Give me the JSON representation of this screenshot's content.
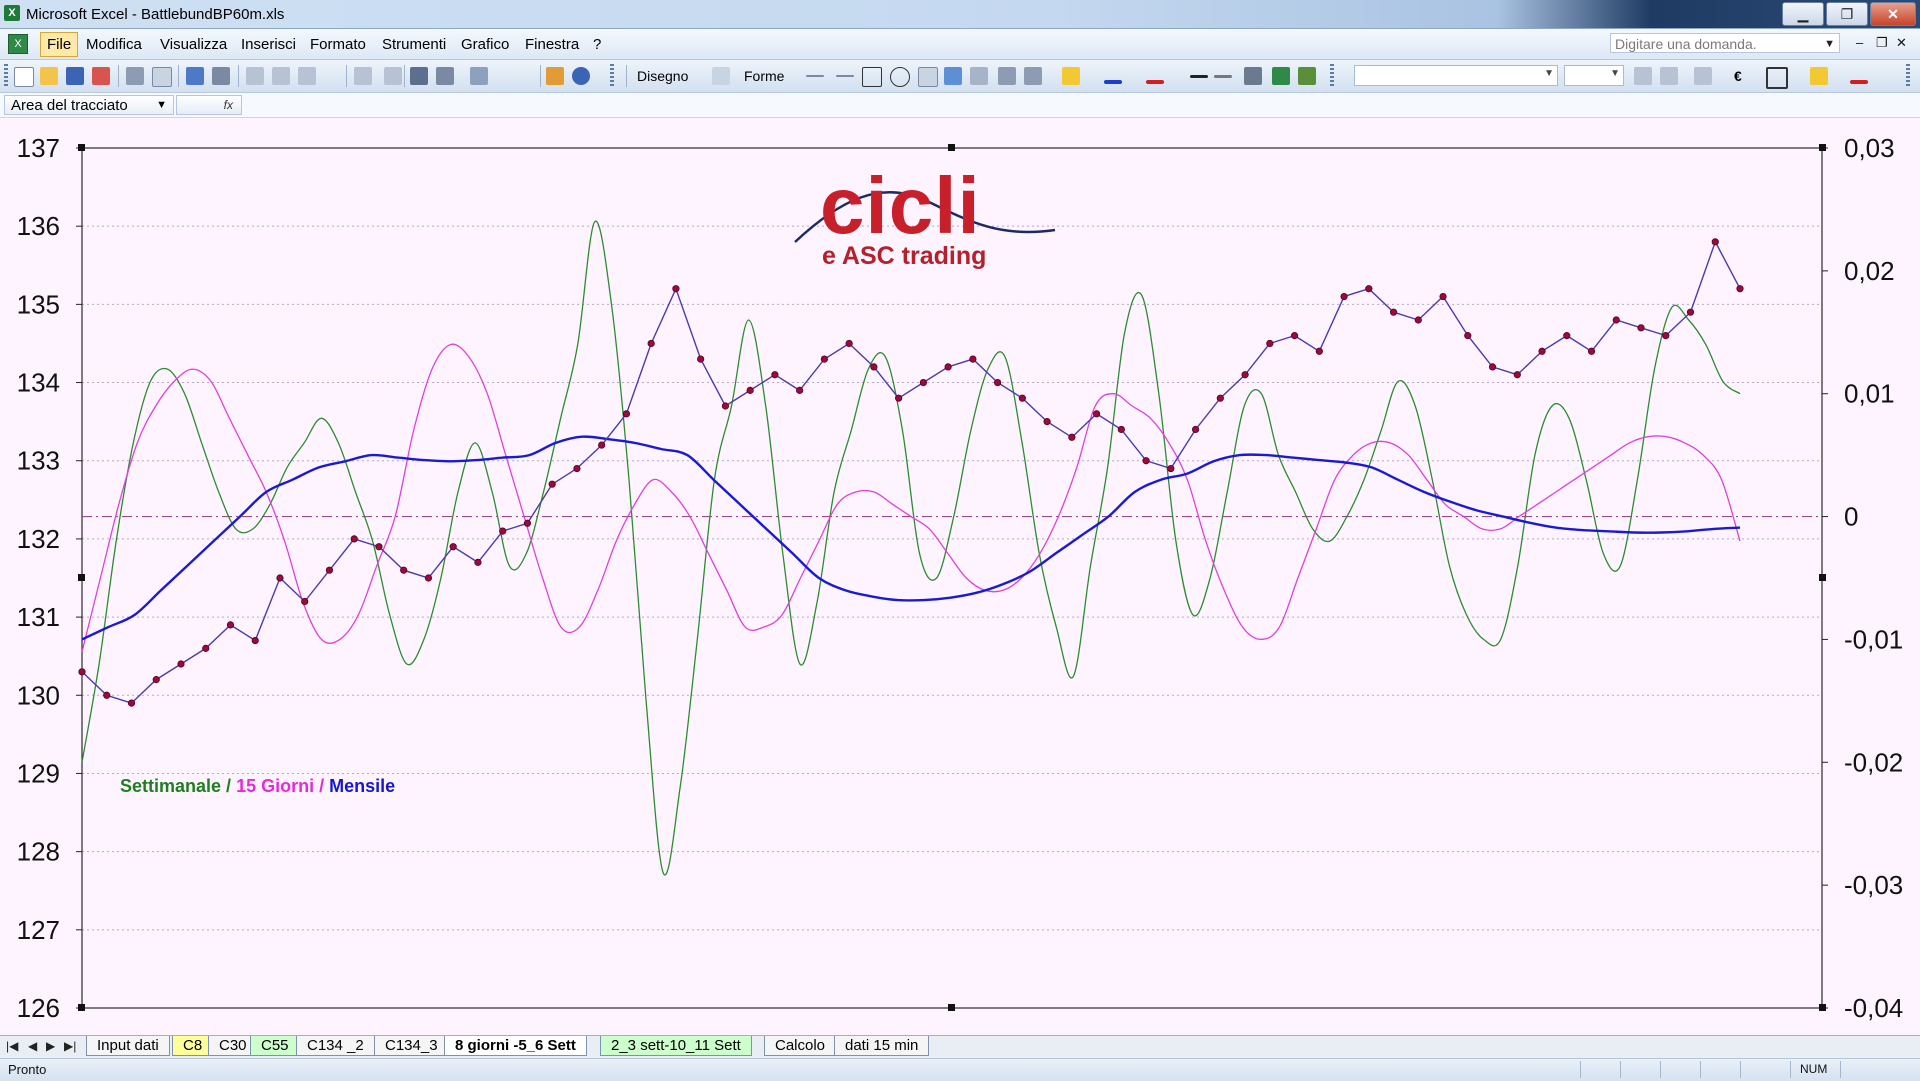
{
  "window": {
    "title": "Microsoft Excel - BattlebundBP60m.xls",
    "minimize": "▁",
    "restore": "❐",
    "close": "✕"
  },
  "menu": {
    "items": [
      "File",
      "Modifica",
      "Visualizza",
      "Inserisci",
      "Formato",
      "Strumenti",
      "Grafico",
      "Finestra",
      "?"
    ],
    "ask_placeholder": "Digitare una domanda.",
    "ask_dropdown": "▼",
    "doc_minimize": "–",
    "doc_restore": "❐",
    "doc_close": "✕"
  },
  "toolbar": {
    "drawing_label": "Disegno",
    "shapes_label": "Forme",
    "euro": "€"
  },
  "namebox": {
    "value": "Area del tracciato",
    "dropdown": "▼",
    "fx": "fx"
  },
  "chart": {
    "logo_main": "cicli",
    "logo_sub": "e ASC trading",
    "legend": {
      "weekly": "Settimanale",
      "sep1": " / ",
      "biweekly": "15 Giorni",
      "sep2": " / ",
      "monthly": "Mensile"
    },
    "colors": {
      "weekly": "#2e8b2e",
      "biweekly": "#e040d8",
      "monthly": "#1a1ad6",
      "price": "#9a0a3a",
      "price_line": "#4a3ab0",
      "zero_line": "#9b4a8a"
    }
  },
  "chart_data": {
    "type": "line",
    "title": "",
    "y_left": {
      "range": [
        126,
        137
      ],
      "ticks": [
        "137",
        "136",
        "135",
        "134",
        "133",
        "132",
        "131",
        "130",
        "129",
        "128",
        "127",
        "126"
      ]
    },
    "y_right": {
      "range": [
        -0.04,
        0.03
      ],
      "ticks": [
        "0,03",
        "0,02",
        "0,01",
        "0",
        "-0,01",
        "-0,02",
        "-0,03",
        "-0,04"
      ]
    },
    "x_count": 100,
    "grid": "horizontal dotted",
    "series": [
      {
        "name": "Settimanale",
        "axis": "right",
        "values": [
          -0.02,
          -0.012,
          -0.002,
          0.006,
          0.011,
          0.012,
          0.01,
          0.006,
          0.002,
          -0.001,
          -0.001,
          0.001,
          0.004,
          0.006,
          0.008,
          0.006,
          0.002,
          -0.002,
          -0.008,
          -0.012,
          -0.01,
          -0.005,
          0.002,
          0.006,
          0.002,
          -0.004,
          -0.003,
          0.002,
          0.008,
          0.014,
          0.024,
          0.017,
          0.003,
          -0.015,
          -0.029,
          -0.022,
          -0.01,
          0.003,
          0.009,
          0.016,
          0.009,
          -0.003,
          -0.012,
          -0.007,
          0.002,
          0.007,
          0.012,
          0.013,
          0.007,
          -0.003,
          -0.005,
          0.0,
          0.007,
          0.012,
          0.013,
          0.006,
          -0.003,
          -0.009,
          -0.013,
          -0.004,
          0.004,
          0.015,
          0.018,
          0.01,
          -0.002,
          -0.008,
          -0.005,
          0.002,
          0.009,
          0.01,
          0.005,
          0.002,
          -0.001,
          -0.002,
          0.0,
          0.003,
          0.007,
          0.011,
          0.009,
          0.003,
          -0.004,
          -0.008,
          -0.01,
          -0.01,
          -0.004,
          0.005,
          0.009,
          0.008,
          0.003,
          -0.003,
          -0.004,
          0.003,
          0.012,
          0.017,
          0.016,
          0.014,
          0.011,
          0.01
        ]
      },
      {
        "name": "15 Giorni",
        "axis": "right",
        "values": [
          -0.011,
          -0.005,
          0.001,
          0.006,
          0.009,
          0.011,
          0.012,
          0.011,
          0.008,
          0.005,
          0.002,
          -0.002,
          -0.007,
          -0.01,
          -0.01,
          -0.008,
          -0.004,
          0.0,
          0.007,
          0.012,
          0.014,
          0.013,
          0.01,
          0.005,
          0.0,
          -0.005,
          -0.009,
          -0.009,
          -0.006,
          -0.002,
          0.001,
          0.003,
          0.002,
          0.0,
          -0.003,
          -0.006,
          -0.009,
          -0.009,
          -0.008,
          -0.005,
          -0.002,
          0.001,
          0.002,
          0.002,
          0.001,
          0.0,
          -0.001,
          -0.003,
          -0.005,
          -0.006,
          -0.006,
          -0.005,
          -0.003,
          0.0,
          0.004,
          0.009,
          0.01,
          0.009,
          0.008,
          0.006,
          0.003,
          -0.002,
          -0.006,
          -0.009,
          -0.01,
          -0.009,
          -0.005,
          -0.001,
          0.003,
          0.005,
          0.006,
          0.006,
          0.005,
          0.003,
          0.001,
          0.0,
          -0.001,
          -0.001,
          0.0,
          0.001,
          0.002,
          0.003,
          0.004,
          0.005,
          0.006,
          0.0065,
          0.0065,
          0.006,
          0.005,
          0.003,
          -0.002
        ]
      },
      {
        "name": "Mensile",
        "axis": "right",
        "values": [
          -0.01,
          -0.009,
          -0.008,
          -0.006,
          -0.004,
          -0.002,
          0.0,
          0.002,
          0.003,
          0.004,
          0.0045,
          0.005,
          0.0048,
          0.0046,
          0.0045,
          0.0046,
          0.0048,
          0.005,
          0.006,
          0.0065,
          0.0063,
          0.006,
          0.0055,
          0.005,
          0.003,
          0.001,
          -0.001,
          -0.003,
          -0.005,
          -0.006,
          -0.0065,
          -0.0068,
          -0.0068,
          -0.0066,
          -0.0062,
          -0.0055,
          -0.0045,
          -0.003,
          -0.0015,
          0.0,
          0.002,
          0.003,
          0.0035,
          0.0045,
          0.005,
          0.005,
          0.0048,
          0.0046,
          0.0044,
          0.004,
          0.003,
          0.002,
          0.0012,
          0.0005,
          0.0,
          -0.0005,
          -0.0009,
          -0.0011,
          -0.0012,
          -0.0013,
          -0.0013,
          -0.0012,
          -0.001,
          -0.0009
        ]
      },
      {
        "name": "Price",
        "axis": "left",
        "values": [
          130.3,
          130.0,
          129.9,
          130.2,
          130.4,
          130.6,
          130.9,
          130.7,
          131.5,
          131.2,
          131.6,
          132.0,
          131.9,
          131.6,
          131.5,
          131.9,
          131.7,
          132.1,
          132.2,
          132.7,
          132.9,
          133.2,
          133.6,
          134.5,
          135.2,
          134.3,
          133.7,
          133.9,
          134.1,
          133.9,
          134.3,
          134.5,
          134.2,
          133.8,
          134.0,
          134.2,
          134.3,
          134.0,
          133.8,
          133.5,
          133.3,
          133.6,
          133.4,
          133.0,
          132.9,
          133.4,
          133.8,
          134.1,
          134.5,
          134.6,
          134.4,
          135.1,
          135.2,
          134.9,
          134.8,
          135.1,
          134.6,
          134.2,
          134.1,
          134.4,
          134.6,
          134.4,
          134.8,
          134.7,
          134.6,
          134.9,
          135.8,
          135.2
        ]
      }
    ],
    "reference_line": {
      "y_right": 0.0,
      "style": "dash-dot"
    }
  },
  "sheets": {
    "tabs": [
      "Input dati",
      "C8",
      "C30",
      "C55",
      "C134 _2",
      "C134_3",
      "8 giorni -5_6 Sett",
      "2_3 sett-10_11 Sett",
      "Calcolo",
      "dati 15 min"
    ],
    "active": "8 giorni -5_6 Sett",
    "nav": [
      "|◀",
      "◀",
      "▶",
      "▶|"
    ]
  },
  "status": {
    "ready": "Pronto",
    "num": "NUM"
  }
}
